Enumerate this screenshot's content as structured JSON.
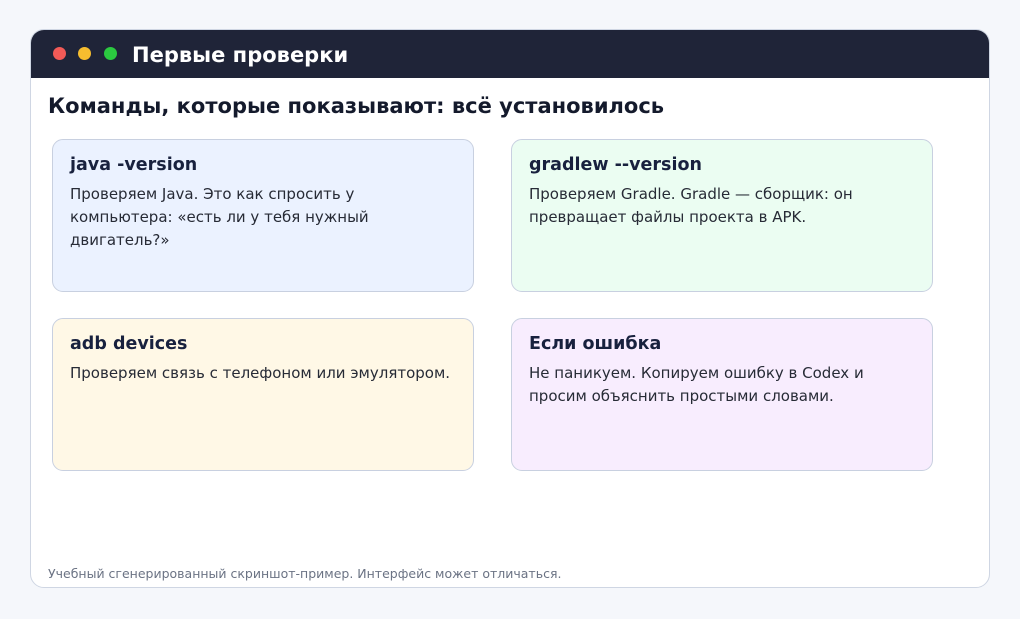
{
  "window": {
    "title": "Первые проверки",
    "controls": {
      "close_color": "#f25a57",
      "minimize_color": "#f6bd2f",
      "maximize_color": "#2bc940"
    }
  },
  "heading": "Команды, которые показывают: всё установилось",
  "cards": [
    {
      "title": "java -version",
      "text": "Проверяем Java. Это как спросить у компьютера: «есть ли у тебя нужный двигатель?»",
      "background": "#ebf2ff"
    },
    {
      "title": "gradlew --version",
      "text": "Проверяем Gradle. Gradle — сборщик: он превращает файлы проекта в APK.",
      "background": "#ebfdf2"
    },
    {
      "title": "adb devices",
      "text": "Проверяем связь с телефоном или эмулятором.",
      "background": "#fff8e6"
    },
    {
      "title": "Если ошибка",
      "text": "Не паникуем. Копируем ошибку в Codex и просим объяснить простыми словами.",
      "background": "#f8edfe"
    }
  ],
  "footer": "Учебный сгенерированный скриншот-пример. Интерфейс может отличаться."
}
